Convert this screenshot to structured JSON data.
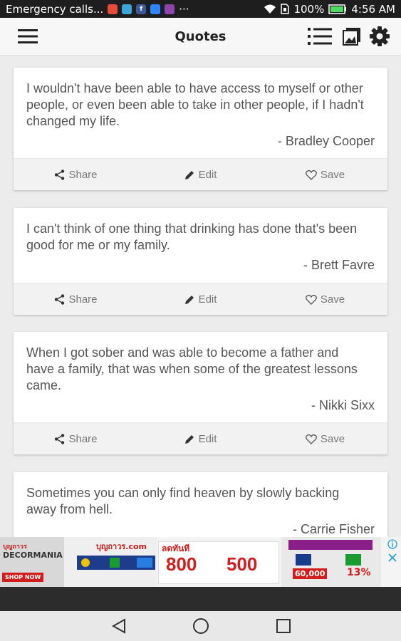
{
  "status_bar": {
    "carrier_text": "Emergency calls...",
    "dots": "···",
    "battery": "100%",
    "time": "4:56 AM"
  },
  "app_bar": {
    "title": "Quotes"
  },
  "actions": {
    "share": "Share",
    "edit": "Edit",
    "save": "Save"
  },
  "quotes": [
    {
      "line1": "I wouldn't have been able to have access to myself or other",
      "line2": "people, or even been able to take in other people, if I hadn't",
      "line3": "changed my life.",
      "author": "- Bradley Cooper"
    },
    {
      "line1": "I can't think of one thing that drinking has done that's been",
      "line2": "good for me or my family.",
      "author": "- Brett Favre"
    },
    {
      "line1": "When I got sober and was able to become a father and",
      "line2": "have a family, that was when some of the greatest lessons",
      "line3": "came.",
      "author": "- Nikki Sixx"
    },
    {
      "line1": "Sometimes you can only find heaven by slowly backing",
      "line2": "away from hell.",
      "author": "- Carrie Fisher"
    }
  ],
  "ad": {
    "brand1": "บุญถาวร",
    "brand2": "DECORMANIA",
    "shop_now": "SHOP NOW",
    "site_name": "บุญถาวร.com",
    "price1": "800",
    "price2": "500",
    "promo_text": "ลดทันที",
    "price3": "60,000",
    "rate": "13%"
  }
}
